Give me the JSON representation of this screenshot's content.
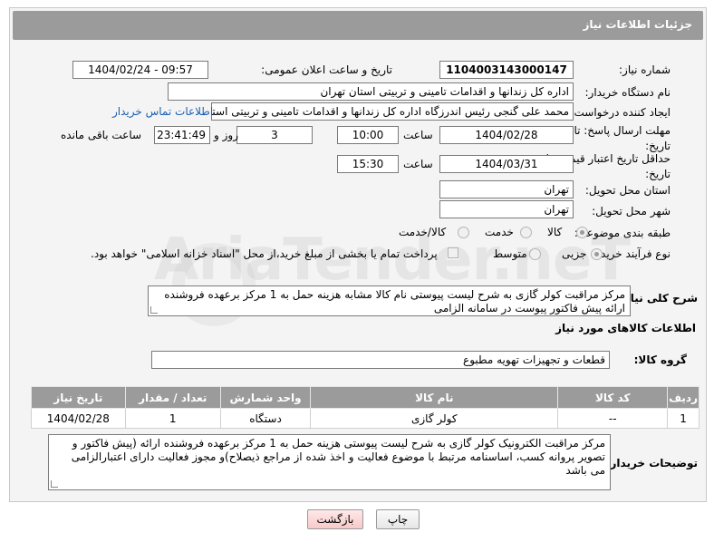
{
  "header": {
    "title": "جزئیات اطلاعات نیاز"
  },
  "form": {
    "need_number": {
      "label": "شماره نیاز:",
      "value": "1104003143000147"
    },
    "announce_datetime": {
      "label": "تاریخ و ساعت اعلان عمومی:",
      "value": "1404/02/24 - 09:57"
    },
    "buyer_org": {
      "label": "نام دستگاه خریدار:",
      "value": "اداره کل زندانها و اقدامات تامینی و تربیتی استان تهران"
    },
    "requester": {
      "label": "ایجاد کننده درخواست:",
      "value": "محمد علی گنجی رئیس اندرزگاه  اداره کل زندانها و اقدامات تامینی و تربیتی استان تهران",
      "contact_link": "اطلاعات تماس خریدار"
    },
    "reply_deadline": {
      "label": "مهلت ارسال پاسخ: تا تاریخ:",
      "date": "1404/02/28",
      "time_label": "ساعت",
      "time": "10:00",
      "days": "3",
      "days_label": "روز و",
      "remaining": "23:41:49",
      "remaining_label": "ساعت باقی مانده"
    },
    "price_validity": {
      "label": "حداقل تاریخ اعتبار قیمت: تا تاریخ:",
      "date": "1404/03/31",
      "time_label": "ساعت",
      "time": "15:30"
    },
    "delivery_province": {
      "label": "استان محل تحویل:",
      "value": "تهران"
    },
    "delivery_city": {
      "label": "شهر محل تحویل:",
      "value": "تهران"
    },
    "category": {
      "label": "طبقه بندی موضوعی:",
      "options": [
        "کالا",
        "خدمت",
        "کالا/خدمت"
      ],
      "selected": "کالا"
    },
    "purchase_process": {
      "label": "نوع فرآیند خرید :",
      "options": [
        "جزیی",
        "متوسط"
      ],
      "selected": "جزیی",
      "payment_note": "پرداخت تمام یا بخشی از مبلغ خرید،از محل \"اسناد خزانه اسلامی\" خواهد بود."
    },
    "summary": {
      "label": "شرح کلی نیاز:",
      "value": "مرکز مراقبت کولر گازی به شرح لیست پیوستی نام کالا مشابه هزینه حمل به 1 مرکز برعهده فروشنده ارائه پیش فاکتور پیوست در سامانه الزامی"
    }
  },
  "goods_section": {
    "title": "اطلاعات کالاهای مورد نیاز",
    "group_label": "گروه کالا:",
    "group_value": "قطعات و تجهیزات تهویه مطبوع",
    "columns": [
      "ردیف",
      "کد کالا",
      "نام کالا",
      "واحد شمارش",
      "تعداد / مقدار",
      "تاریخ نیاز"
    ],
    "rows": [
      [
        "1",
        "--",
        "کولر گازی",
        "دستگاه",
        "1",
        "1404/02/28"
      ]
    ]
  },
  "buyer_notes": {
    "label": "توضیحات خریدار:",
    "value": "مرکز مراقبت الکترونیک  کولر گازی به شرح لیست پیوستی  هزینه حمل به 1 مرکز برعهده فروشنده ارائه (پیش فاکتور و  تصویر پروانه کسب، اساسنامه مرتبط با موضوع فعالیت و اخذ شده از مراجع ذیصلاح)و مجوز فعالیت دارای اعتبارالزامی می باشد"
  },
  "buttons": {
    "print": "چاپ",
    "back": "بازگشت"
  },
  "colors": {
    "header_bg": "#9b9b9b",
    "panel_bg": "#f4f4f4",
    "link": "#1a5fb4"
  },
  "watermark": "AriaTender.neT"
}
